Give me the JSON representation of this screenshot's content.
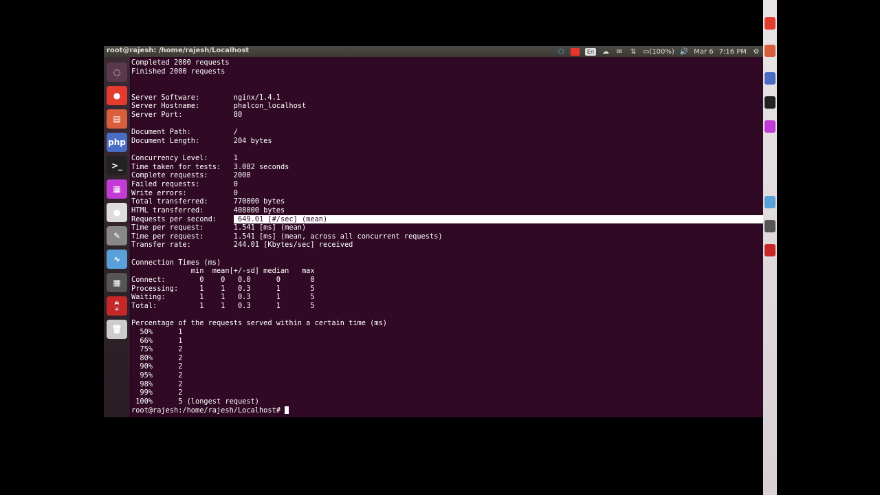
{
  "window": {
    "title": "root@rajesh: /home/rajesh/Localhost"
  },
  "indicators": {
    "battery": "(100%)",
    "date": "Mar 6",
    "time": "7:16 PM",
    "keyboard": "En"
  },
  "launcher": {
    "items": [
      {
        "name": "dash-icon",
        "color": "#5a3a4a",
        "glyph": "◌"
      },
      {
        "name": "chrome-icon",
        "color": "#e33b2e",
        "glyph": "●"
      },
      {
        "name": "text-editor-icon",
        "color": "#d95f3c",
        "glyph": "▤"
      },
      {
        "name": "php-icon",
        "color": "#4b6cc5",
        "glyph": "php"
      },
      {
        "name": "terminal-icon",
        "color": "#222222",
        "glyph": ">_"
      },
      {
        "name": "app-icon-pink",
        "color": "#c23bd4",
        "glyph": "▦"
      },
      {
        "name": "app-icon-white",
        "color": "#dddddd",
        "glyph": "●"
      },
      {
        "name": "draw-icon",
        "color": "#888888",
        "glyph": "✎"
      },
      {
        "name": "monitor-icon",
        "color": "#5aa0d8",
        "glyph": "∿"
      },
      {
        "name": "calculator-icon",
        "color": "#555555",
        "glyph": "▦"
      },
      {
        "name": "wine-icon",
        "color": "#c62828",
        "glyph": "🍷"
      },
      {
        "name": "trash-icon",
        "color": "#cccccc",
        "glyph": "🗑"
      }
    ]
  },
  "terminal": {
    "lines": [
      "Completed 2000 requests",
      "Finished 2000 requests",
      "",
      "",
      "Server Software:        nginx/1.4.1",
      "Server Hostname:        phalcon_localhost",
      "Server Port:            80",
      "",
      "Document Path:          /",
      "Document Length:        204 bytes",
      "",
      "Concurrency Level:      1",
      "Time taken for tests:   3.082 seconds",
      "Complete requests:      2000",
      "Failed requests:        0",
      "Write errors:           0",
      "Total transferred:      770000 bytes",
      "HTML transferred:       408000 bytes",
      "Requests per second:    ",
      "Time per request:       1.541 [ms] (mean)",
      "Time per request:       1.541 [ms] (mean, across all concurrent requests)",
      "Transfer rate:          244.01 [Kbytes/sec] received",
      "",
      "Connection Times (ms)",
      "              min  mean[+/-sd] median   max",
      "Connect:        0    0   0.0      0       0",
      "Processing:     1    1   0.3      1       5",
      "Waiting:        1    1   0.3      1       5",
      "Total:          1    1   0.3      1       5",
      "",
      "Percentage of the requests served within a certain time (ms)",
      "  50%      1",
      "  66%      1",
      "  75%      2",
      "  80%      2",
      "  90%      2",
      "  95%      2",
      "  98%      2",
      "  99%      2",
      " 100%      5 (longest request)"
    ],
    "selected": " 649.01 [#/sec] (mean)",
    "prompt": "root@rajesh:/home/rajesh/Localhost# "
  }
}
